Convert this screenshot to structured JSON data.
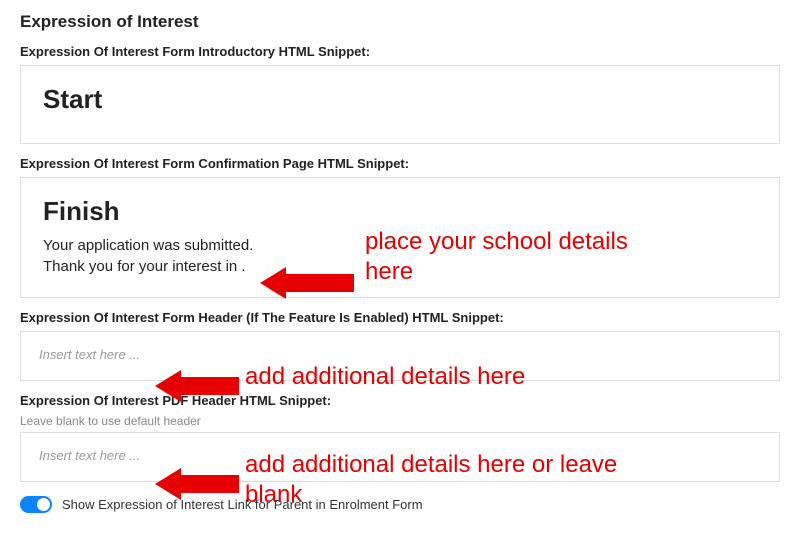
{
  "section_title": "Expression of Interest",
  "fields": {
    "intro": {
      "label": "Expression Of Interest Form Introductory HTML Snippet:",
      "content_heading": "Start"
    },
    "confirmation": {
      "label": "Expression Of Interest Form Confirmation Page HTML Snippet:",
      "content_heading": "Finish",
      "content_line1": "Your application was submitted.",
      "content_line2": "Thank you for your interest in ."
    },
    "header": {
      "label": "Expression Of Interest Form Header (If The Feature Is Enabled) HTML Snippet:",
      "placeholder": "Insert text here ..."
    },
    "pdf_header": {
      "label": "Expression Of Interest PDF Header HTML Snippet:",
      "helper": "Leave blank to use default header",
      "placeholder": "Insert text here ..."
    }
  },
  "toggle": {
    "label": "Show Expression of Interest Link for Parent in Enrolment Form",
    "state": "on"
  },
  "annotations": {
    "a1": "place your school details here",
    "a2": "add additional details here",
    "a3": "add additional details here or leave blank"
  }
}
